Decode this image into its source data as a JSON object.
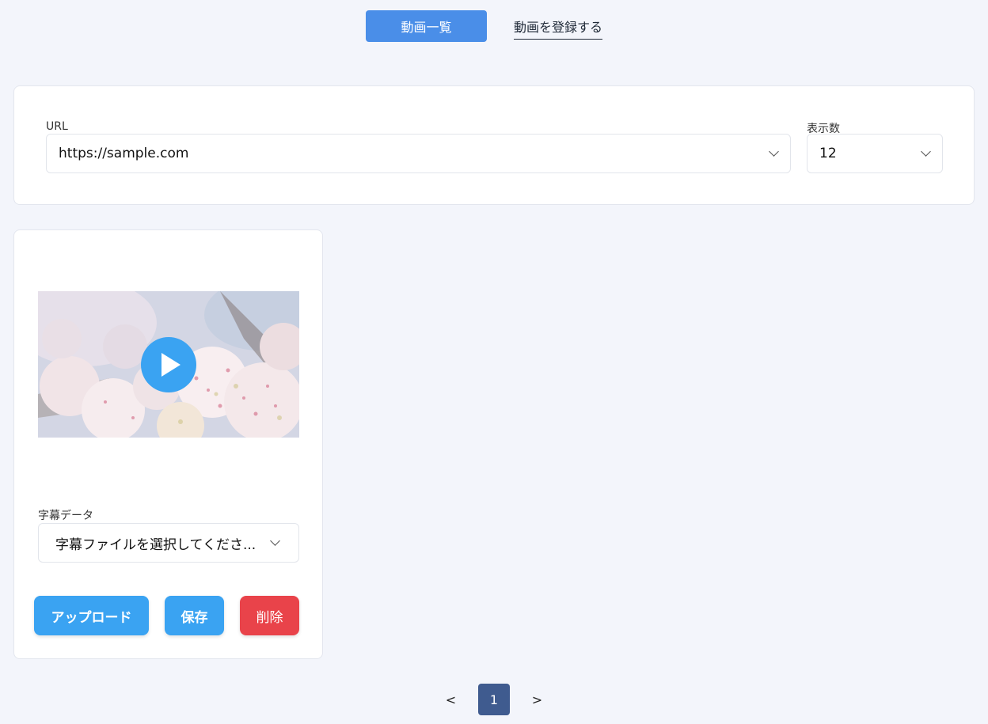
{
  "nav": {
    "list_label": "動画一覧",
    "register_label": "動画を登録する"
  },
  "filter": {
    "url_label": "URL",
    "url_value": "https://sample.com",
    "count_label": "表示数",
    "count_value": "12"
  },
  "video": {
    "subtitle_label": "字幕データ",
    "subtitle_placeholder": "字幕ファイルを選択してくださ...",
    "upload_label": "アップロード",
    "save_label": "保存",
    "delete_label": "削除"
  },
  "pagination": {
    "prev": "<",
    "current": "1",
    "next": ">"
  },
  "colors": {
    "nav_active": "#4a8ee8",
    "primary_button": "#3aa3f2",
    "delete_button": "#e9434a",
    "page_active": "#3f5b8f",
    "background": "#f3f5fb"
  }
}
